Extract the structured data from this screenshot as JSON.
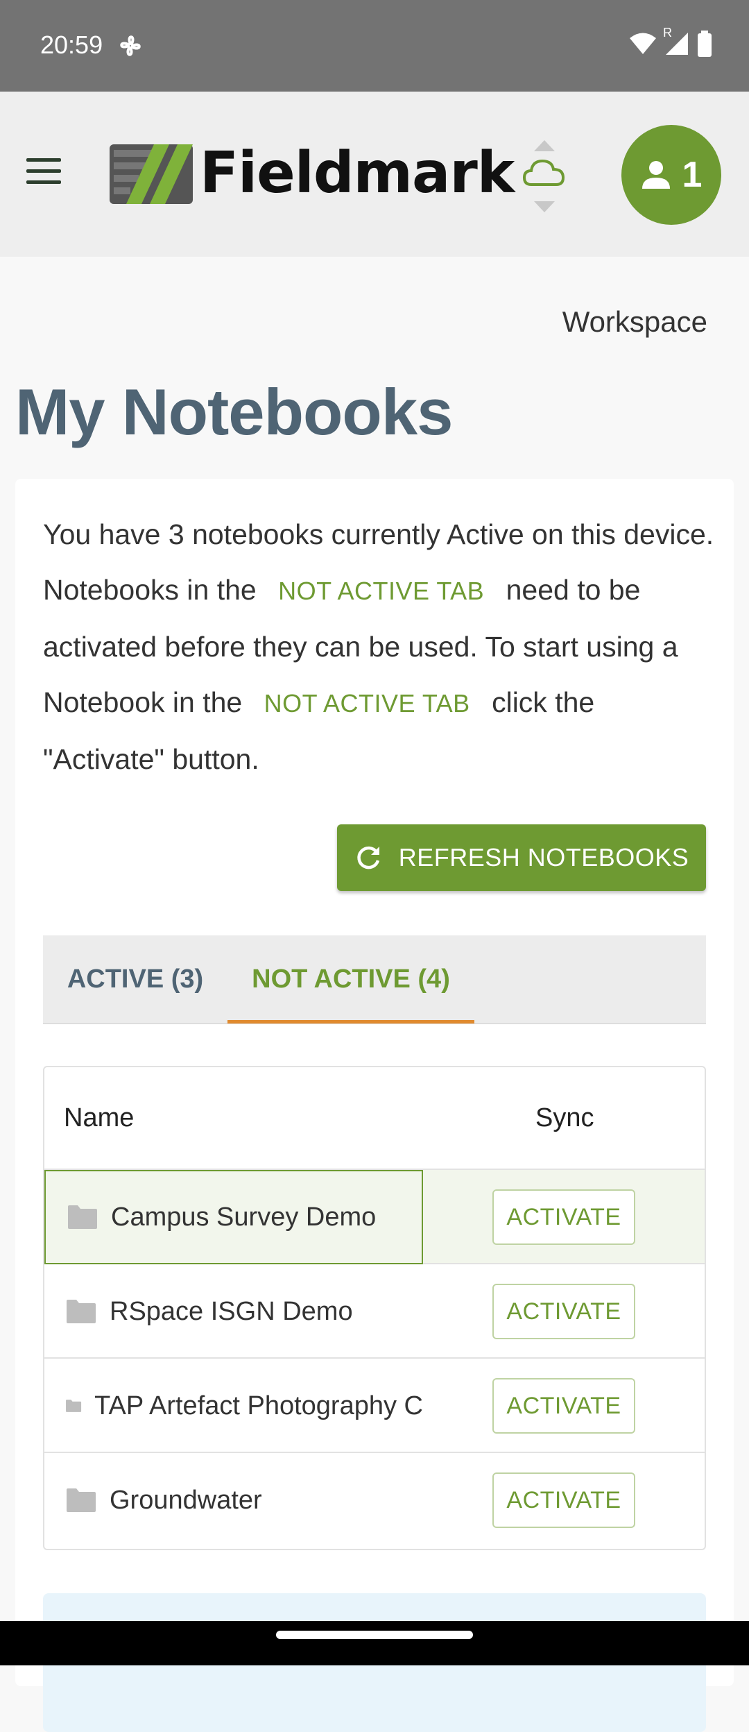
{
  "status_bar": {
    "time": "20:59",
    "icons": [
      "fan-icon",
      "wifi-icon",
      "signal-icon",
      "battery-icon"
    ],
    "roaming": "R"
  },
  "app_bar": {
    "logo_text": "Fieldmark",
    "user_count": "1",
    "colors": {
      "accent": "#6e9a32",
      "background": "#eeeeee"
    }
  },
  "breadcrumb": "Workspace",
  "page_title": "My Notebooks",
  "intro": {
    "part1": "You have 3 notebooks currently Active on this device. Notebooks in the",
    "link1": "Not Active tab",
    "part2": "need to be activated before they can be used. To start using a Notebook in the",
    "link2": "Not Active tab",
    "part3": "click the \"Activate\" button."
  },
  "refresh_button": "REFRESH NOTEBOOKS",
  "tabs": [
    {
      "label": "ACTIVE (3)"
    },
    {
      "label": "NOT ACTIVE (4)"
    }
  ],
  "table": {
    "headers": {
      "name": "Name",
      "sync": "Sync"
    },
    "rows": [
      {
        "name": "Campus Survey Demo",
        "action": "ACTIVATE"
      },
      {
        "name": "RSpace ISGN Demo",
        "action": "ACTIVATE"
      },
      {
        "name": "TAP Artefact Photography C",
        "action": "ACTIVATE"
      },
      {
        "name": "Groundwater",
        "action": "ACTIVATE"
      }
    ]
  }
}
